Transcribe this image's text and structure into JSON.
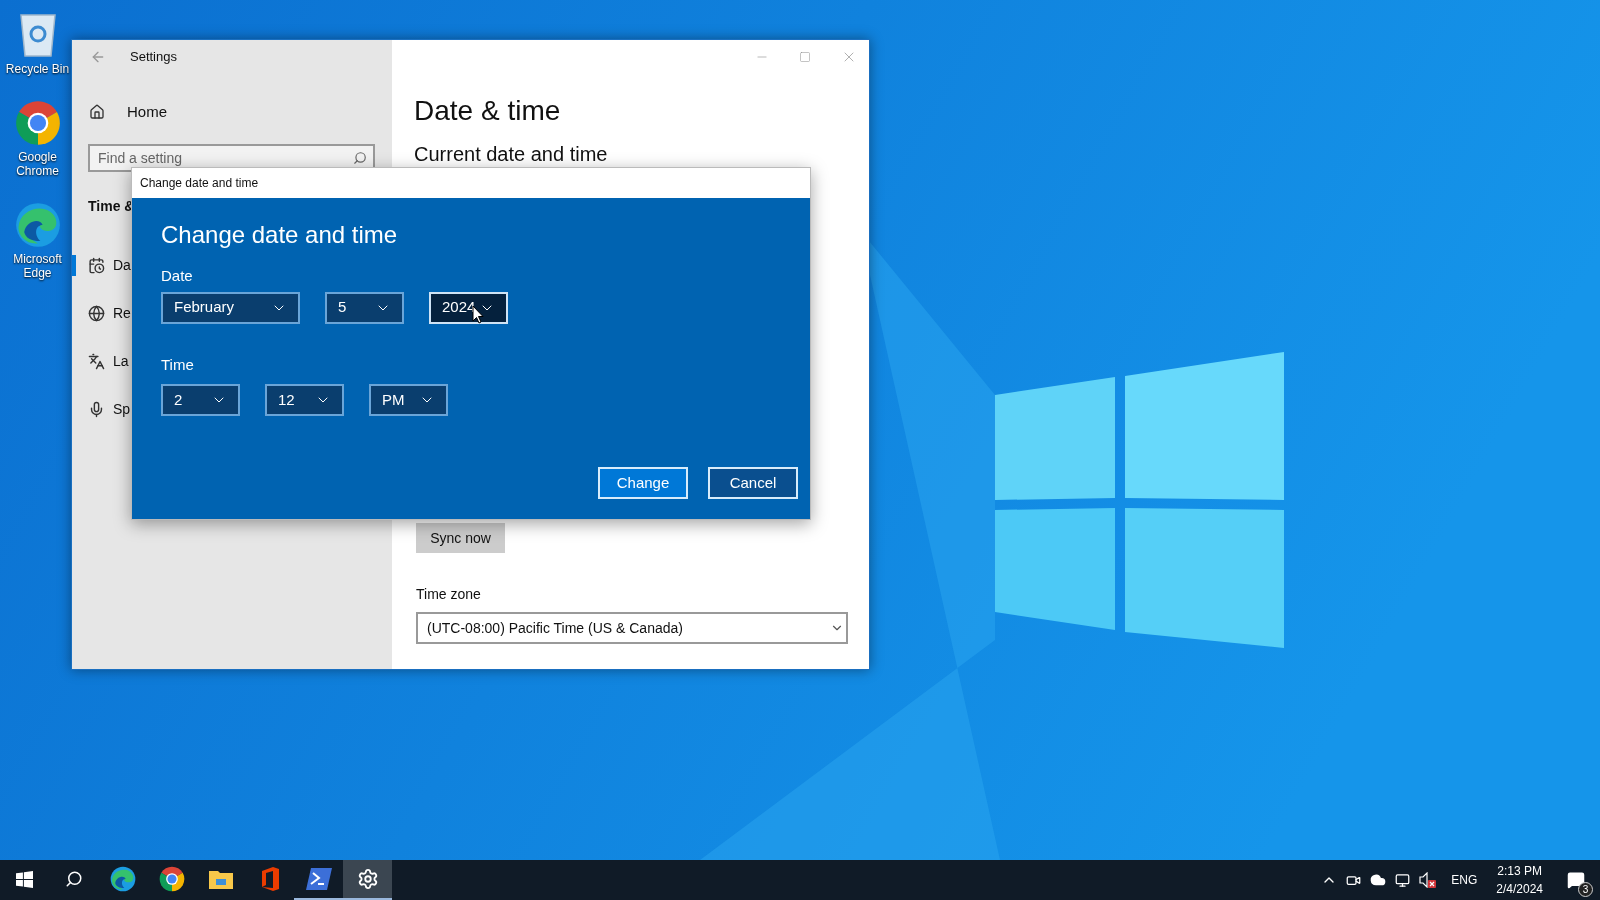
{
  "desktop_icons": [
    {
      "kind": "recycle-bin",
      "label": "Recycle Bin"
    },
    {
      "kind": "chrome",
      "label": "Google Chrome"
    },
    {
      "kind": "edge",
      "label": "Microsoft Edge"
    }
  ],
  "settings": {
    "title": "Settings",
    "home": "Home",
    "search": {
      "placeholder": "Find a setting"
    },
    "section": "Time &",
    "nav": [
      {
        "kind": "calendar",
        "label": "Da",
        "selected": true
      },
      {
        "kind": "globe",
        "label": "Re",
        "selected": false
      },
      {
        "kind": "language",
        "label": "La",
        "selected": false
      },
      {
        "kind": "mic",
        "label": "Sp",
        "selected": false
      }
    ],
    "page_title": "Date & time",
    "heading": "Current date and time",
    "sync_button": "Sync now",
    "time_zone": {
      "label": "Time zone",
      "value": "(UTC-08:00) Pacific Time (US & Canada)"
    }
  },
  "dialog": {
    "title": "Change date and time",
    "heading": "Change date and time",
    "date_label": "Date",
    "date_fields": [
      {
        "value": "February",
        "hovered": false
      },
      {
        "value": "5",
        "hovered": false
      },
      {
        "value": "2024",
        "hovered": true
      }
    ],
    "time_label": "Time",
    "time_fields": [
      {
        "value": "2",
        "hovered": false
      },
      {
        "value": "12",
        "hovered": false
      },
      {
        "value": "PM",
        "hovered": false
      }
    ],
    "buttons": [
      {
        "label": "Change",
        "kind": "primary"
      },
      {
        "label": "Cancel",
        "kind": "secondary"
      }
    ]
  },
  "taskbar": {
    "apps": [
      {
        "kind": "start",
        "running": false,
        "active": false
      },
      {
        "kind": "search",
        "running": false,
        "active": false
      },
      {
        "kind": "edge",
        "running": false,
        "active": false
      },
      {
        "kind": "chrome",
        "running": false,
        "active": false
      },
      {
        "kind": "folder",
        "running": false,
        "active": false
      },
      {
        "kind": "office",
        "running": false,
        "active": false
      },
      {
        "kind": "powershell",
        "running": true,
        "active": false
      },
      {
        "kind": "settings",
        "running": true,
        "active": true
      }
    ],
    "tray": {
      "language": "ENG",
      "time": "2:13 PM",
      "date": "2/4/2024",
      "notifications": "3"
    }
  }
}
